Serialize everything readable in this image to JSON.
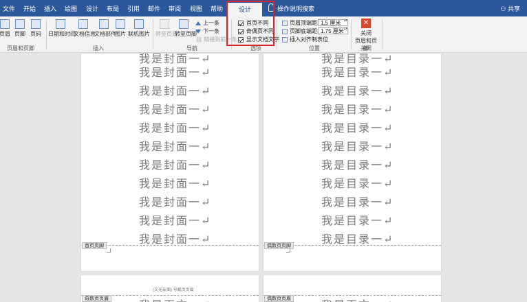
{
  "tabs": [
    "文件",
    "开始",
    "插入",
    "绘图",
    "设计",
    "布局",
    "引用",
    "邮件",
    "审阅",
    "视图",
    "帮助"
  ],
  "active_tab": "设计",
  "search_hint": "操作说明搜索",
  "share": "共享",
  "ribbon": {
    "header_footer_group": {
      "label": "页眉和页脚",
      "buttons": [
        "页眉",
        "页脚",
        "页码"
      ]
    },
    "insert_group": {
      "label": "插入",
      "buttons": [
        "日期和时间",
        "文档信息",
        "文档部件",
        "图片",
        "联机图片"
      ]
    },
    "nav_group": {
      "label": "导航",
      "goto_header": "转至页眉",
      "goto_footer": "转至页脚",
      "previous": "上一条",
      "next": "下一条",
      "link_previous": "链接到前一条"
    },
    "options_group": {
      "label": "选项",
      "items": [
        {
          "label": "首页不同",
          "checked": true
        },
        {
          "label": "奇偶页不同",
          "checked": true
        },
        {
          "label": "显示文档文字",
          "checked": true
        }
      ]
    },
    "position_group": {
      "label": "位置",
      "header_top_label": "页眉顶端距离:",
      "header_top_value": "1.5 厘米",
      "footer_bottom_label": "页脚底端距离:",
      "footer_bottom_value": "1.75 厘米",
      "insert_align_tab": "插入对齐制表位"
    },
    "close_group": {
      "label": "关闭",
      "button": "关闭\n页眉和页脚"
    }
  },
  "pages": {
    "left_top": {
      "line_text": "我是封面一↵",
      "footer_tag": "首页页脚"
    },
    "right_top": {
      "line_text": "我是目录一↵",
      "footer_tag": "偶数页页脚"
    },
    "left_bottom": {
      "header_tag": "奇数页页眉",
      "header_text": "(文无友面)  号截页页眉",
      "line_text": "我是再文一↵"
    },
    "right_bottom": {
      "header_tag": "偶数页页眉",
      "line_text": "我是再文一↵"
    }
  },
  "colors": {
    "accent": "#2b579a",
    "highlight": "#d9262c",
    "close": "#d9462c"
  }
}
